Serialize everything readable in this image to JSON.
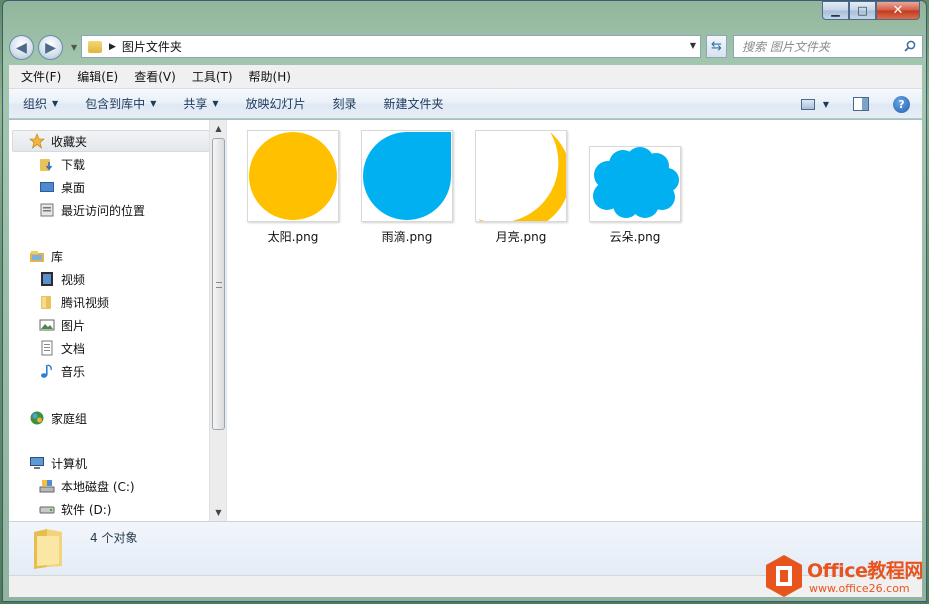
{
  "window": {
    "caption": {
      "minimize": "▁",
      "maximize": "□",
      "close": "✕"
    }
  },
  "address": {
    "path": "图片文件夹",
    "search_placeholder": "搜索 图片文件夹"
  },
  "menu": [
    "文件(F)",
    "编辑(E)",
    "查看(V)",
    "工具(T)",
    "帮助(H)"
  ],
  "toolbar": {
    "organize": "组织",
    "include_in_library": "包含到库中",
    "share": "共享",
    "slideshow": "放映幻灯片",
    "burn": "刻录",
    "new_folder": "新建文件夹"
  },
  "nav": {
    "favorites": {
      "label": "收藏夹",
      "icon": "star-icon",
      "items": [
        {
          "label": "下载",
          "icon": "download-folder-icon"
        },
        {
          "label": "桌面",
          "icon": "desktop-icon"
        },
        {
          "label": "最近访问的位置",
          "icon": "recent-places-icon"
        }
      ]
    },
    "libraries": {
      "label": "库",
      "icon": "library-icon",
      "items": [
        {
          "label": "视频",
          "icon": "video-icon"
        },
        {
          "label": "腾讯视频",
          "icon": "folder-icon"
        },
        {
          "label": "图片",
          "icon": "pictures-icon"
        },
        {
          "label": "文档",
          "icon": "documents-icon"
        },
        {
          "label": "音乐",
          "icon": "music-icon"
        }
      ]
    },
    "homegroup": {
      "label": "家庭组",
      "icon": "homegroup-icon"
    },
    "computer": {
      "label": "计算机",
      "icon": "computer-icon",
      "items": [
        {
          "label": "本地磁盘 (C:)",
          "icon": "system-drive-icon"
        },
        {
          "label": "软件 (D:)",
          "icon": "drive-icon"
        }
      ]
    }
  },
  "files": [
    {
      "name": "太阳.png",
      "shape": "sun",
      "color": "#ffc000"
    },
    {
      "name": "雨滴.png",
      "shape": "raindrop",
      "color": "#00b0f0"
    },
    {
      "name": "月亮.png",
      "shape": "moon",
      "color": "#ffc000"
    },
    {
      "name": "云朵.png",
      "shape": "cloud",
      "color": "#00b0f0"
    }
  ],
  "details": {
    "count_text": "4 个对象"
  },
  "watermark": {
    "title": "Office教程网",
    "url": "www.office26.com"
  }
}
